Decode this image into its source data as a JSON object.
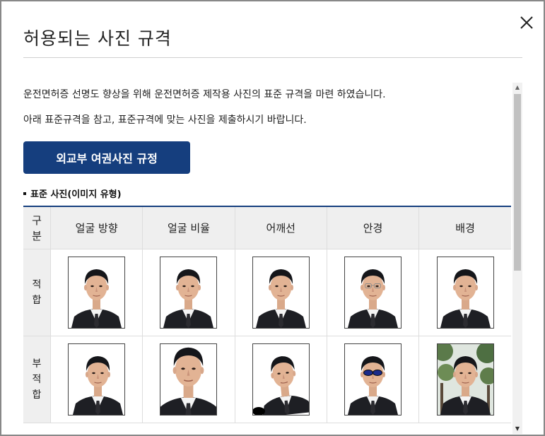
{
  "dialog": {
    "title": "허용되는 사진 규격",
    "close_icon": "close-icon"
  },
  "content": {
    "paragraph1": "운전면허증 선명도 향상을 위해 운전면허증 제작용 사진의 표준 규격을 마련 하였습니다.",
    "paragraph2": "아래 표준규격을 참고, 표준규격에 맞는 사진을 제출하시기 바랍니다.",
    "button_label": "외교부 여권사진 규정",
    "section_title": "표준 사진(이미지 유형)"
  },
  "table": {
    "header_label_chars": [
      "구",
      "분"
    ],
    "columns": [
      "얼굴 방향",
      "얼굴 비율",
      "어깨선",
      "안경",
      "배경"
    ],
    "rows": [
      {
        "label_chars": [
          "적",
          "합"
        ],
        "variants": [
          "normal",
          "normal",
          "normal",
          "clear-glasses",
          "normal"
        ]
      },
      {
        "label_chars": [
          "부",
          "적",
          "합"
        ],
        "variants": [
          "turned",
          "closeup",
          "tilted",
          "sunglasses",
          "tree-background"
        ]
      }
    ]
  },
  "colors": {
    "accent": "#153e7e",
    "header_bg": "#efefef"
  }
}
